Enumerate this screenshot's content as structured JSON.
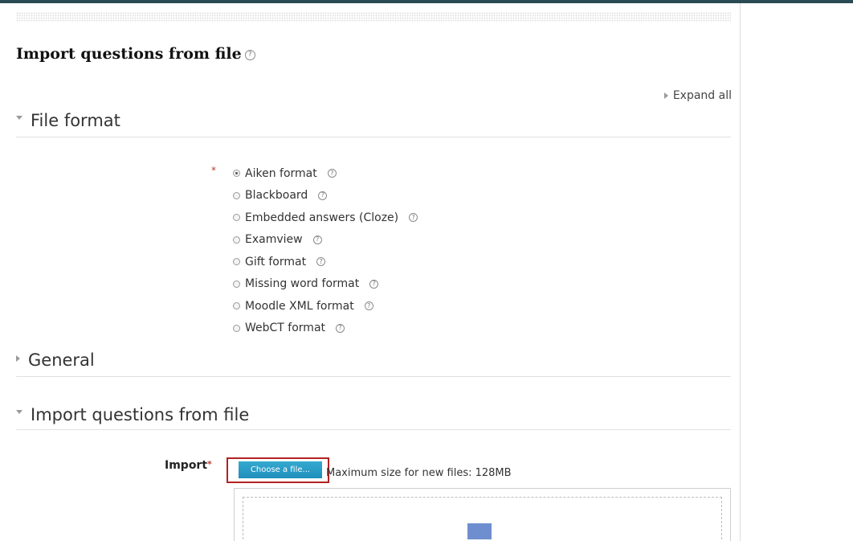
{
  "page": {
    "title": "Import questions from file",
    "expand_all": "Expand all"
  },
  "sections": {
    "file_format": "File format",
    "general": "General",
    "import": "Import questions from file"
  },
  "formats": {
    "required_mark": "*",
    "selected_index": 0,
    "items": [
      {
        "label": "Aiken format"
      },
      {
        "label": "Blackboard"
      },
      {
        "label": "Embedded answers (Cloze)"
      },
      {
        "label": "Examview"
      },
      {
        "label": "Gift format"
      },
      {
        "label": "Missing word format"
      },
      {
        "label": "Moodle XML format"
      },
      {
        "label": "WebCT format"
      }
    ]
  },
  "import_field": {
    "label": "Import",
    "required_mark": "*",
    "button": "Choose a file...",
    "max_size": "Maximum size for new files: 128MB"
  },
  "icons": {
    "help": "help-icon",
    "collapse": "triangle-down-icon",
    "expand": "triangle-right-icon",
    "upload": "down-arrow-icon"
  },
  "colors": {
    "accent": "#2a9fd0",
    "highlight_border": "#b22222",
    "required": "#c0392b"
  }
}
